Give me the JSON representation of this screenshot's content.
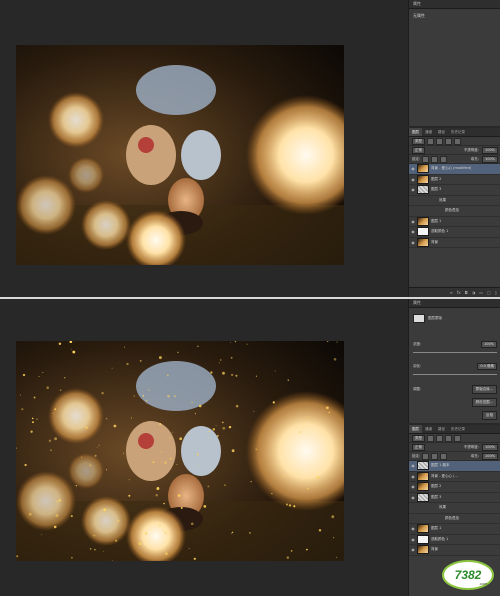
{
  "top": {
    "properties_panel": {
      "header": "属性",
      "title": "无属性"
    },
    "layers_panel": {
      "tabs": [
        "图层",
        "通道",
        "路径",
        "历史记录"
      ],
      "filter_select": "类型",
      "blend_mode": "正常",
      "opacity_label": "不透明度:",
      "opacity_value": "100%",
      "lock_label": "锁定:",
      "fill_label": "填充:",
      "fill_value": "100%",
      "layers": [
        {
          "name": "背景 - 爱心心 (modified)",
          "thumb": "photo",
          "indent": 0,
          "selected": true
        },
        {
          "name": "图层 2",
          "thumb": "photo",
          "indent": 0,
          "selected": false
        },
        {
          "name": "图层 3",
          "thumb": "checker",
          "indent": 0,
          "selected": false
        },
        {
          "name": "效果",
          "thumb": "",
          "indent": 1,
          "selected": false
        },
        {
          "name": "颜色叠加",
          "thumb": "",
          "indent": 2,
          "selected": false
        },
        {
          "name": "图层 1",
          "thumb": "photo",
          "indent": 0,
          "selected": false
        },
        {
          "name": "选取颜色 1",
          "thumb": "white",
          "indent": 0,
          "selected": false
        },
        {
          "name": "背景",
          "thumb": "photo",
          "indent": 0,
          "selected": false
        }
      ]
    }
  },
  "bottom": {
    "properties_panel": {
      "header": "属性",
      "title": "图层蒙版",
      "density_label": "浓度:",
      "density_value": "100%",
      "feather_label": "羽化:",
      "feather_value": "0.0 像素",
      "adjust_label": "调整:",
      "buttons": [
        "蒙版边缘...",
        "颜色范围...",
        "反相"
      ]
    },
    "layers_panel": {
      "tabs": [
        "图层",
        "通道",
        "路径",
        "历史记录"
      ],
      "filter_select": "类型",
      "blend_mode": "正常",
      "opacity_label": "不透明度:",
      "opacity_value": "100%",
      "lock_label": "锁定:",
      "fill_label": "填充:",
      "fill_value": "100%",
      "layers": [
        {
          "name": "图层 1 副本",
          "thumb": "checker",
          "indent": 0,
          "selected": true
        },
        {
          "name": "背景 - 爱心心 (...",
          "thumb": "photo",
          "indent": 0,
          "selected": false
        },
        {
          "name": "图层 2",
          "thumb": "photo",
          "indent": 0,
          "selected": false
        },
        {
          "name": "图层 3",
          "thumb": "checker",
          "indent": 0,
          "selected": false
        },
        {
          "name": "效果",
          "thumb": "",
          "indent": 1,
          "selected": false
        },
        {
          "name": "颜色叠加",
          "thumb": "",
          "indent": 2,
          "selected": false
        },
        {
          "name": "图层 1",
          "thumb": "photo",
          "indent": 0,
          "selected": false
        },
        {
          "name": "选取颜色 1",
          "thumb": "white",
          "indent": 0,
          "selected": false
        },
        {
          "name": "背景",
          "thumb": "photo",
          "indent": 0,
          "selected": false
        }
      ]
    }
  },
  "watermark": {
    "text": "7382",
    "suffix": ".com"
  }
}
